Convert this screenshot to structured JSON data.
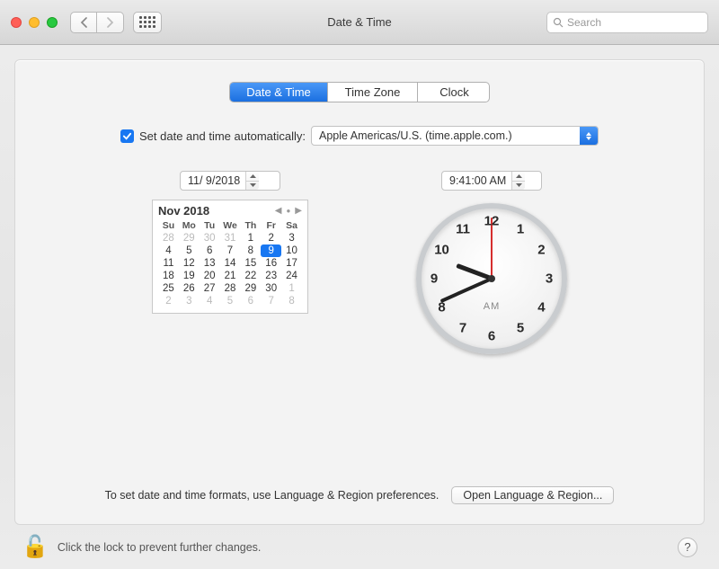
{
  "window": {
    "title": "Date & Time"
  },
  "search": {
    "placeholder": "Search"
  },
  "tabs": {
    "date_time": "Date & Time",
    "time_zone": "Time Zone",
    "clock": "Clock"
  },
  "auto": {
    "label": "Set date and time automatically:",
    "checked": true,
    "server": "Apple Americas/U.S. (time.apple.com.)"
  },
  "date_field": "11/ 9/2018",
  "time_field": "9:41:00 AM",
  "calendar": {
    "title": "Nov 2018",
    "dow": [
      "Su",
      "Mo",
      "Tu",
      "We",
      "Th",
      "Fr",
      "Sa"
    ],
    "weeks": [
      [
        {
          "d": "28",
          "dim": true
        },
        {
          "d": "29",
          "dim": true
        },
        {
          "d": "30",
          "dim": true
        },
        {
          "d": "31",
          "dim": true
        },
        {
          "d": "1"
        },
        {
          "d": "2"
        },
        {
          "d": "3"
        }
      ],
      [
        {
          "d": "4"
        },
        {
          "d": "5"
        },
        {
          "d": "6"
        },
        {
          "d": "7"
        },
        {
          "d": "8"
        },
        {
          "d": "9",
          "sel": true
        },
        {
          "d": "10"
        }
      ],
      [
        {
          "d": "11"
        },
        {
          "d": "12"
        },
        {
          "d": "13"
        },
        {
          "d": "14"
        },
        {
          "d": "15"
        },
        {
          "d": "16"
        },
        {
          "d": "17"
        }
      ],
      [
        {
          "d": "18"
        },
        {
          "d": "19"
        },
        {
          "d": "20"
        },
        {
          "d": "21"
        },
        {
          "d": "22"
        },
        {
          "d": "23"
        },
        {
          "d": "24"
        }
      ],
      [
        {
          "d": "25"
        },
        {
          "d": "26"
        },
        {
          "d": "27"
        },
        {
          "d": "28"
        },
        {
          "d": "29"
        },
        {
          "d": "30"
        },
        {
          "d": "1",
          "dim": true
        }
      ],
      [
        {
          "d": "2",
          "dim": true
        },
        {
          "d": "3",
          "dim": true
        },
        {
          "d": "4",
          "dim": true
        },
        {
          "d": "5",
          "dim": true
        },
        {
          "d": "6",
          "dim": true
        },
        {
          "d": "7",
          "dim": true
        },
        {
          "d": "8",
          "dim": true
        }
      ]
    ]
  },
  "clock": {
    "numbers": [
      "12",
      "1",
      "2",
      "3",
      "4",
      "5",
      "6",
      "7",
      "8",
      "9",
      "10",
      "11"
    ],
    "ampm": "AM",
    "hour_angle": 290.5,
    "minute_angle": 246,
    "second_angle": 0
  },
  "hint": "To set date and time formats, use Language & Region preferences.",
  "open_lang_button": "Open Language & Region...",
  "lock_text": "Click the lock to prevent further changes.",
  "help_label": "?"
}
